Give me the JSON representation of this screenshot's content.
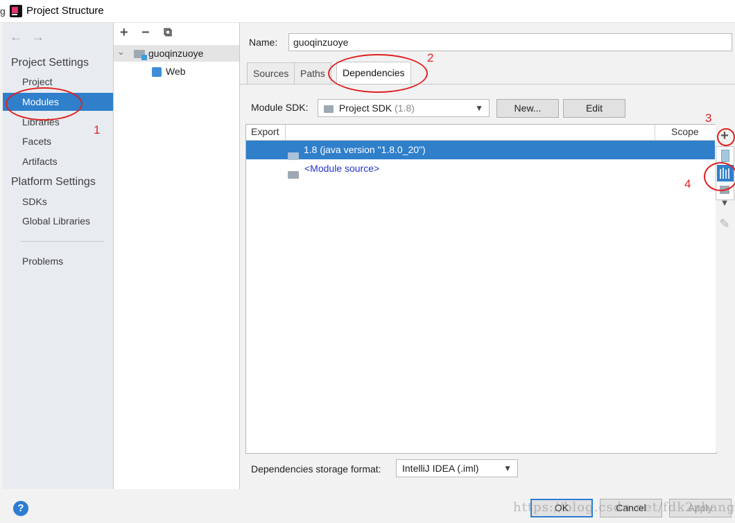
{
  "window": {
    "title": "Project Structure",
    "edge_char": "g"
  },
  "nav": {
    "back": "←",
    "forward": "→",
    "section_project": "Project Settings",
    "items_project": [
      "Project",
      "Modules",
      "Libraries",
      "Facets",
      "Artifacts"
    ],
    "section_platform": "Platform Settings",
    "items_platform": [
      "SDKs",
      "Global Libraries"
    ],
    "problems": "Problems"
  },
  "tree": {
    "add": "+",
    "remove": "−",
    "copy": "⧉",
    "module": "guoqinzuoye",
    "facet": "Web",
    "expand": "⌄"
  },
  "content": {
    "name_label": "Name:",
    "name_value": "guoqinzuoye",
    "tabs": [
      "Sources",
      "Paths",
      "Dependencies"
    ],
    "sdk_label": "Module SDK:",
    "sdk_value": "Project SDK",
    "sdk_version": "(1.8)",
    "new_button": "New...",
    "edit_button": "Edit",
    "columns": {
      "export": "Export",
      "scope": "Scope"
    },
    "rows": [
      "1.8 (java version \"1.8.0_20\")",
      "<Module source>"
    ],
    "storage_label": "Dependencies storage format:",
    "storage_value": "IntelliJ IDEA (.iml)"
  },
  "side_icons": {
    "add": "+",
    "down": "▼",
    "edit": "✎"
  },
  "bottom": {
    "help": "?",
    "ok": "OK",
    "cancel": "Cancel",
    "apply": "Apply"
  },
  "annotations": {
    "n1": "1",
    "n2": "2",
    "n3": "3",
    "n4": "4"
  },
  "watermark": "https://blog.csdn.net/fdk2zhang",
  "colors": {
    "selection": "#2f7fcb",
    "annotation": "#e02020",
    "link": "#2233cc"
  }
}
